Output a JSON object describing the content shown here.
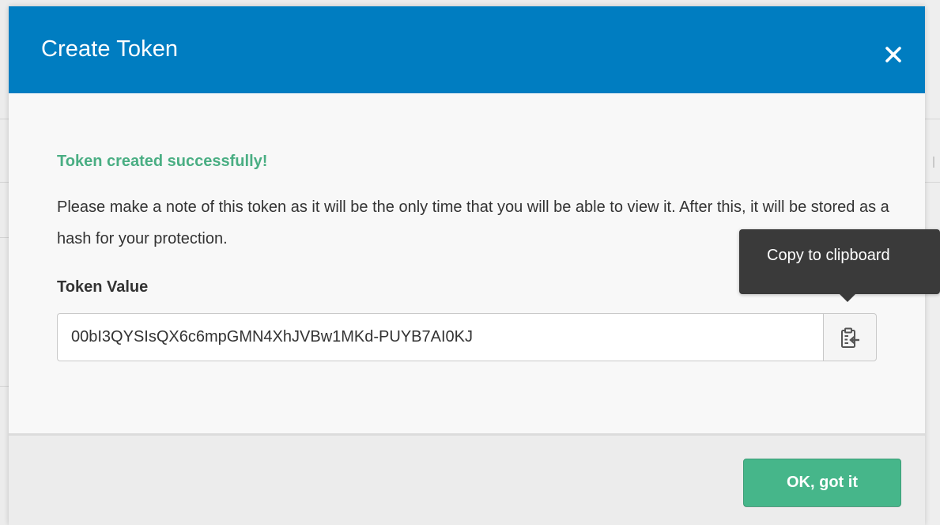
{
  "modal": {
    "title": "Create Token",
    "close_icon": "close-icon"
  },
  "body": {
    "success_message": "Token created successfully!",
    "description": "Please make a note of this token as it will be the only time that you will be able to view it. After this, it will be stored as a hash for your protection.",
    "token_label": "Token Value",
    "token_value": "00bI3QYSIsQX6c6mpGMN4XhJVBw1MKd-PUYB7AI0KJ",
    "copy_icon": "clipboard-icon",
    "tooltip": "Copy to clipboard"
  },
  "footer": {
    "ok_label": "OK, got it"
  },
  "colors": {
    "header_bg": "#007dc1",
    "success_text": "#4aae83",
    "ok_button_bg": "#46b68a",
    "tooltip_bg": "#3a3a3a"
  }
}
